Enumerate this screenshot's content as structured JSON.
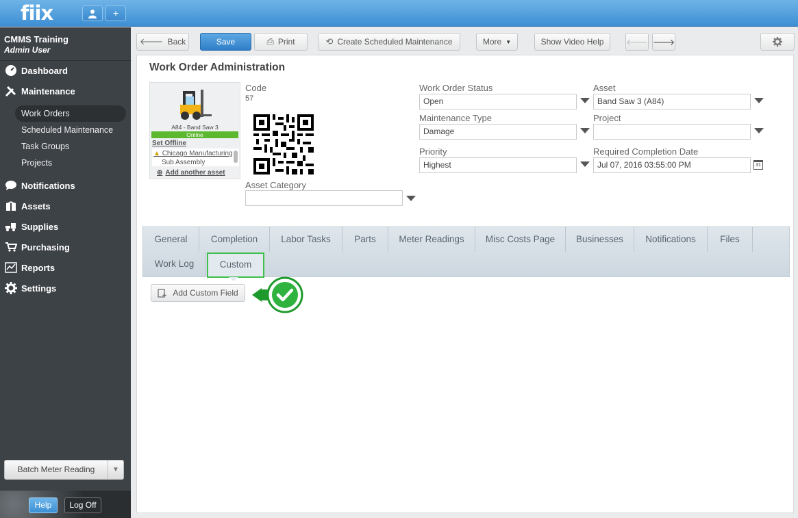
{
  "app": {
    "logo": "fiix"
  },
  "sidebar": {
    "org_name": "CMMS Training",
    "org_user": "Admin User",
    "nav": [
      {
        "label": "Dashboard",
        "icon": "dashboard-icon"
      },
      {
        "label": "Maintenance",
        "icon": "tools-icon"
      },
      {
        "label": "Notifications",
        "icon": "chat-bubble-icon"
      },
      {
        "label": "Assets",
        "icon": "box-icon"
      },
      {
        "label": "Supplies",
        "icon": "forklift-icon"
      },
      {
        "label": "Purchasing",
        "icon": "cart-icon"
      },
      {
        "label": "Reports",
        "icon": "chart-icon"
      },
      {
        "label": "Settings",
        "icon": "gear-icon"
      }
    ],
    "sub_items": [
      "Work Orders",
      "Scheduled Maintenance",
      "Task Groups",
      "Projects"
    ],
    "batch_meter": "Batch Meter Reading",
    "help": "Help",
    "logoff": "Log Off"
  },
  "toolbar": {
    "back": "Back",
    "save": "Save",
    "print": "Print",
    "create_sm": "Create Scheduled Maintenance",
    "more": "More",
    "video_help": "Show Video Help"
  },
  "page": {
    "title": "Work Order Administration"
  },
  "asset_card": {
    "name": "A84 - Band Saw 3",
    "status": "Online",
    "set_offline": "Set Offline",
    "location1": "Chicago Manufacturing",
    "location2": "Sub Assembly",
    "add_asset": "Add another asset"
  },
  "form": {
    "code_label": "Code",
    "code_value": "57",
    "asset_category_label": "Asset Category",
    "asset_category_value": "",
    "status_label": "Work Order Status",
    "status_value": "Open",
    "mtype_label": "Maintenance Type",
    "mtype_value": "Damage",
    "priority_label": "Priority",
    "priority_value": "Highest",
    "asset_label": "Asset",
    "asset_value": "Band Saw 3 (A84)",
    "project_label": "Project",
    "project_value": "",
    "rcd_label": "Required Completion Date",
    "rcd_value": "Jul 07, 2016 03:55:00 PM",
    "calendar_day": "31"
  },
  "tabs": [
    "General",
    "Completion",
    "Labor Tasks",
    "Parts",
    "Meter Readings",
    "Misc Costs Page",
    "Businesses",
    "Notifications",
    "Files",
    "Work Log",
    "Custom"
  ],
  "custom": {
    "add_field": "Add Custom Field"
  },
  "colors": {
    "accent": "#3d8fd3",
    "highlight": "#3fc04a",
    "online": "#5cb82e"
  }
}
